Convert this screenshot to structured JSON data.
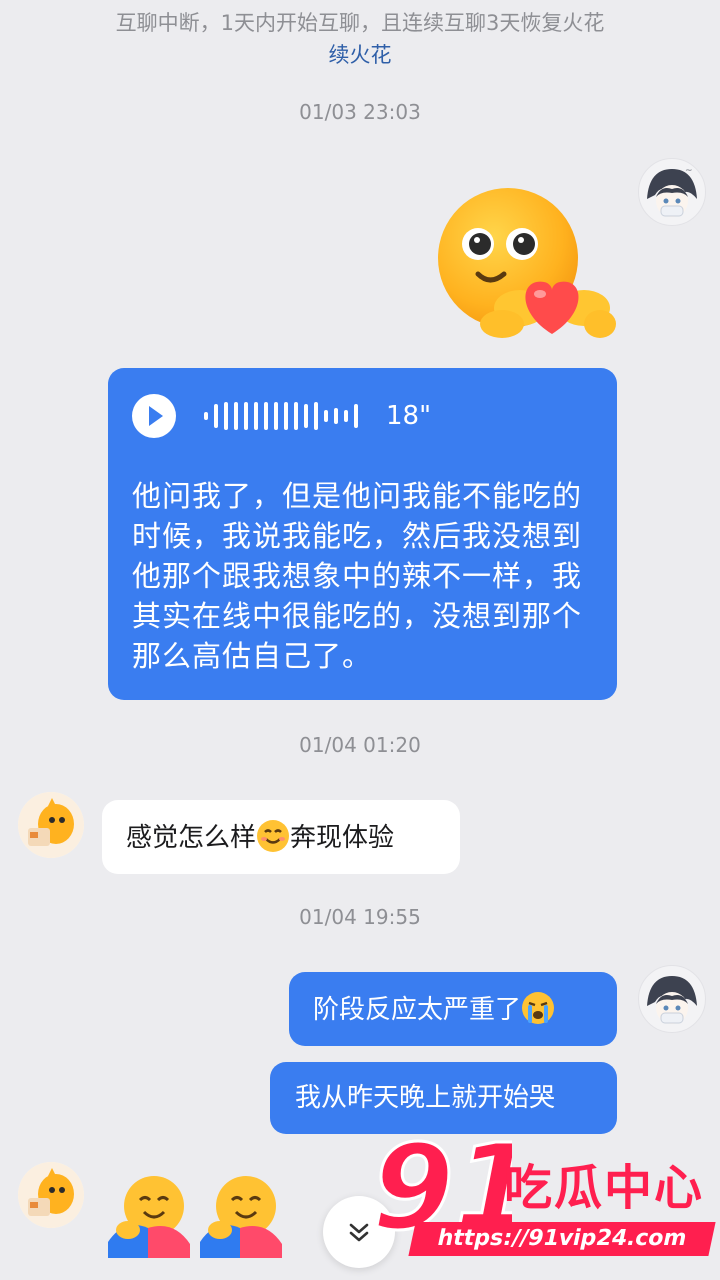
{
  "system_notice": {
    "text": "互聊中断，1天内开始互聊，且连续互聊3天恢复火花",
    "link": "续火花"
  },
  "timestamps": [
    "01/03 23:03",
    "01/04 01:20",
    "01/04 19:55"
  ],
  "messages": {
    "voice": {
      "duration": "18\"",
      "transcript": "他问我了，但是他问我能不能吃的时候，我说我能吃，然后我没想到他那个跟我想象中的辣不一样，我其实在线中很能吃的，没想到那个那么高估自己了。"
    },
    "friend_1": {
      "text_before_emoji": "感觉怎么样",
      "text_after_emoji": "奔现体验"
    },
    "me_1": "阶段反应太严重了",
    "me_2": "我从昨天晚上就开始哭"
  },
  "watermark": {
    "brand_number": "91",
    "brand_text": "吃瓜中心",
    "url": "https://91vip24.com"
  },
  "colors": {
    "outgoing_bubble": "#3a7df0",
    "incoming_bubble": "#ffffff",
    "background": "#ececef",
    "watermark": "#ff1f4f"
  },
  "icons": [
    "sticker-heart-hands-icon",
    "play-icon",
    "smile-emoji-icon",
    "crying-emoji-icon",
    "hug-emoji-icon",
    "chevron-double-down-icon"
  ]
}
